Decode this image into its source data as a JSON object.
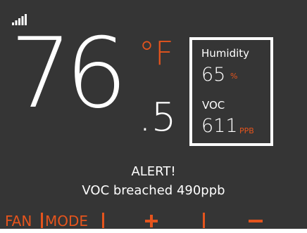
{
  "colors": {
    "background": "#353535",
    "accent": "#e5541d",
    "text": "#ffffff"
  },
  "status": {
    "signal_icon": "signal-bars-icon"
  },
  "temperature": {
    "whole": "76",
    "unit": "°F",
    "fraction": ".5"
  },
  "readings": {
    "humidity_label": "Humidity",
    "humidity_value": "65",
    "humidity_unit": "%",
    "voc_label": "VOC",
    "voc_value": "611",
    "voc_unit": "PPB"
  },
  "alert": {
    "title": "ALERT!",
    "message": "VOC breached 490ppb"
  },
  "nav": {
    "fan_label": "FAN",
    "mode_label": "MODE",
    "increase_icon": "plus-icon",
    "decrease_icon": "minus-icon"
  }
}
